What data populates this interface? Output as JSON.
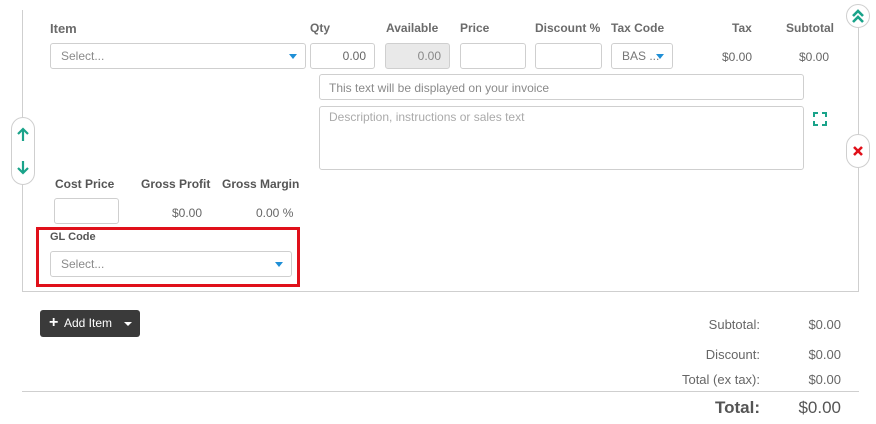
{
  "headers": {
    "item": "Item",
    "qty": "Qty",
    "available": "Available",
    "price": "Price",
    "discount": "Discount %",
    "tax_code": "Tax Code",
    "tax": "Tax",
    "subtotal": "Subtotal"
  },
  "row": {
    "item_placeholder": "Select...",
    "qty": "0.00",
    "available": "0.00",
    "price": "",
    "discount": "",
    "tax_code": "BAS ...",
    "tax": "$0.00",
    "subtotal": "$0.00",
    "invoice_text_placeholder": "This text will be displayed on your invoice",
    "description_placeholder": "Description, instructions or sales text"
  },
  "costing": {
    "cost_price_label": "Cost Price",
    "gross_profit_label": "Gross Profit",
    "gross_margin_label": "Gross Margin",
    "cost_price": "",
    "gross_profit": "$0.00",
    "gross_margin": "0.00 %"
  },
  "gl": {
    "label": "GL Code",
    "placeholder": "Select..."
  },
  "icons": {
    "collapse": "double-chevron-up-icon",
    "move_up": "arrow-up-icon",
    "move_down": "arrow-down-icon",
    "remove": "close-icon",
    "expand": "expand-icon",
    "add": "plus-icon",
    "dropdown": "caret-down-icon"
  },
  "colors": {
    "accent_teal": "#1aa38a",
    "remove_red": "#e0101a",
    "highlight_red": "#e0101a",
    "caret_blue": "#1f8fd6",
    "button_dark": "#3a3a3a"
  },
  "actions": {
    "add_item": "Add Item"
  },
  "totals": {
    "subtotal_label": "Subtotal:",
    "subtotal_value": "$0.00",
    "discount_label": "Discount:",
    "discount_value": "$0.00",
    "ex_tax_label": "Total (ex tax):",
    "ex_tax_value": "$0.00",
    "total_label": "Total:",
    "total_value": "$0.00"
  }
}
